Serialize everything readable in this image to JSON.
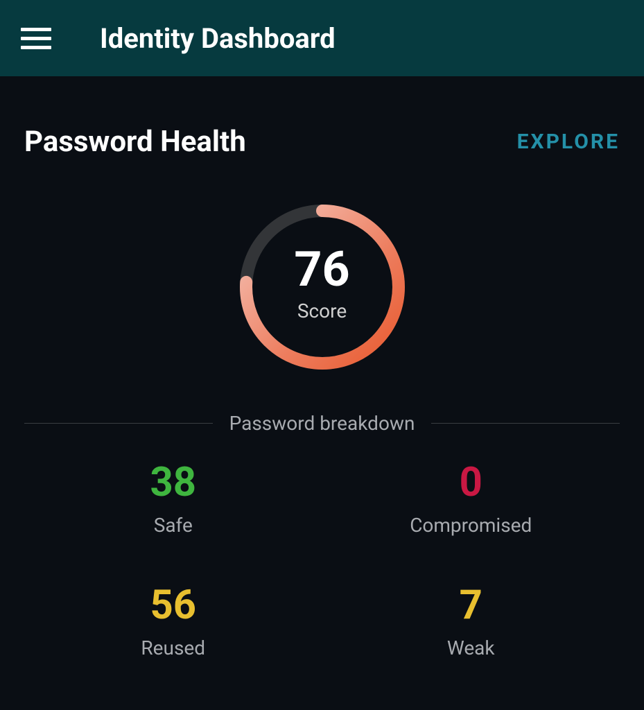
{
  "header": {
    "title": "Identity Dashboard"
  },
  "section": {
    "title": "Password Health",
    "explore_label": "EXPLORE"
  },
  "score": {
    "value": "76",
    "label": "Score",
    "percent": 76
  },
  "breakdown": {
    "label": "Password breakdown",
    "stats": [
      {
        "value": "38",
        "label": "Safe",
        "color_class": "color-safe"
      },
      {
        "value": "0",
        "label": "Compromised",
        "color_class": "color-compromised"
      },
      {
        "value": "56",
        "label": "Reused",
        "color_class": "color-reused"
      },
      {
        "value": "7",
        "label": "Weak",
        "color_class": "color-weak"
      }
    ]
  },
  "colors": {
    "header_bg": "#063a3f",
    "body_bg": "#0a0e14",
    "explore": "#2490a8",
    "ring_track": "#333538",
    "ring_start": "#e85a2f",
    "ring_end": "#f5c8bd"
  }
}
